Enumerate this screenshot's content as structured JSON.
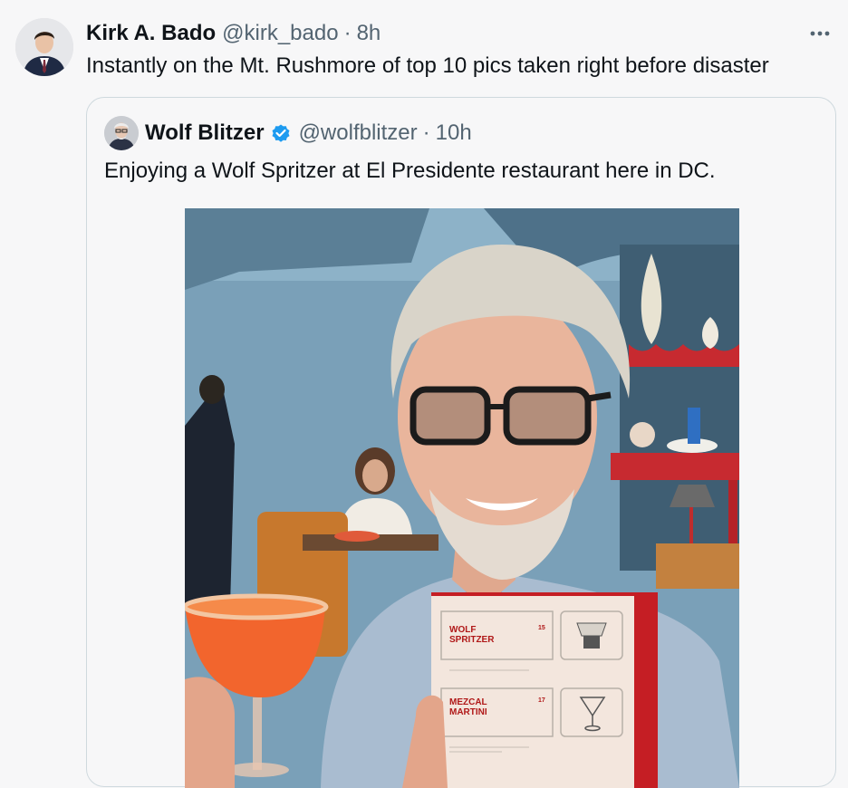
{
  "tweet": {
    "author_name": "Kirk A. Bado",
    "author_handle": "@kirk_bado",
    "separator": "·",
    "time": "8h",
    "text": "Instantly on the Mt. Rushmore of top 10 pics taken right before disaster",
    "more_icon": "more-horizontal-icon"
  },
  "quote": {
    "author_name": "Wolf Blitzer",
    "author_handle": "@wolfblitzer",
    "separator": "·",
    "time": "10h",
    "verified_icon": "verified-badge-icon",
    "text": "Enjoying a Wolf Spritzer at El Presidente restaurant here in DC.",
    "photo": {
      "menu_item_1": "WOLF",
      "menu_item_1b": "SPRITZER",
      "menu_price_1": "15",
      "menu_item_2": "MEZCAL",
      "menu_item_2b": "MARTINI",
      "menu_price_2": "17"
    }
  },
  "colors": {
    "text_primary": "#0f1419",
    "text_secondary": "#536471",
    "border": "#cfd9de",
    "verified": "#1d9bf0",
    "background": "#f7f7f8"
  }
}
